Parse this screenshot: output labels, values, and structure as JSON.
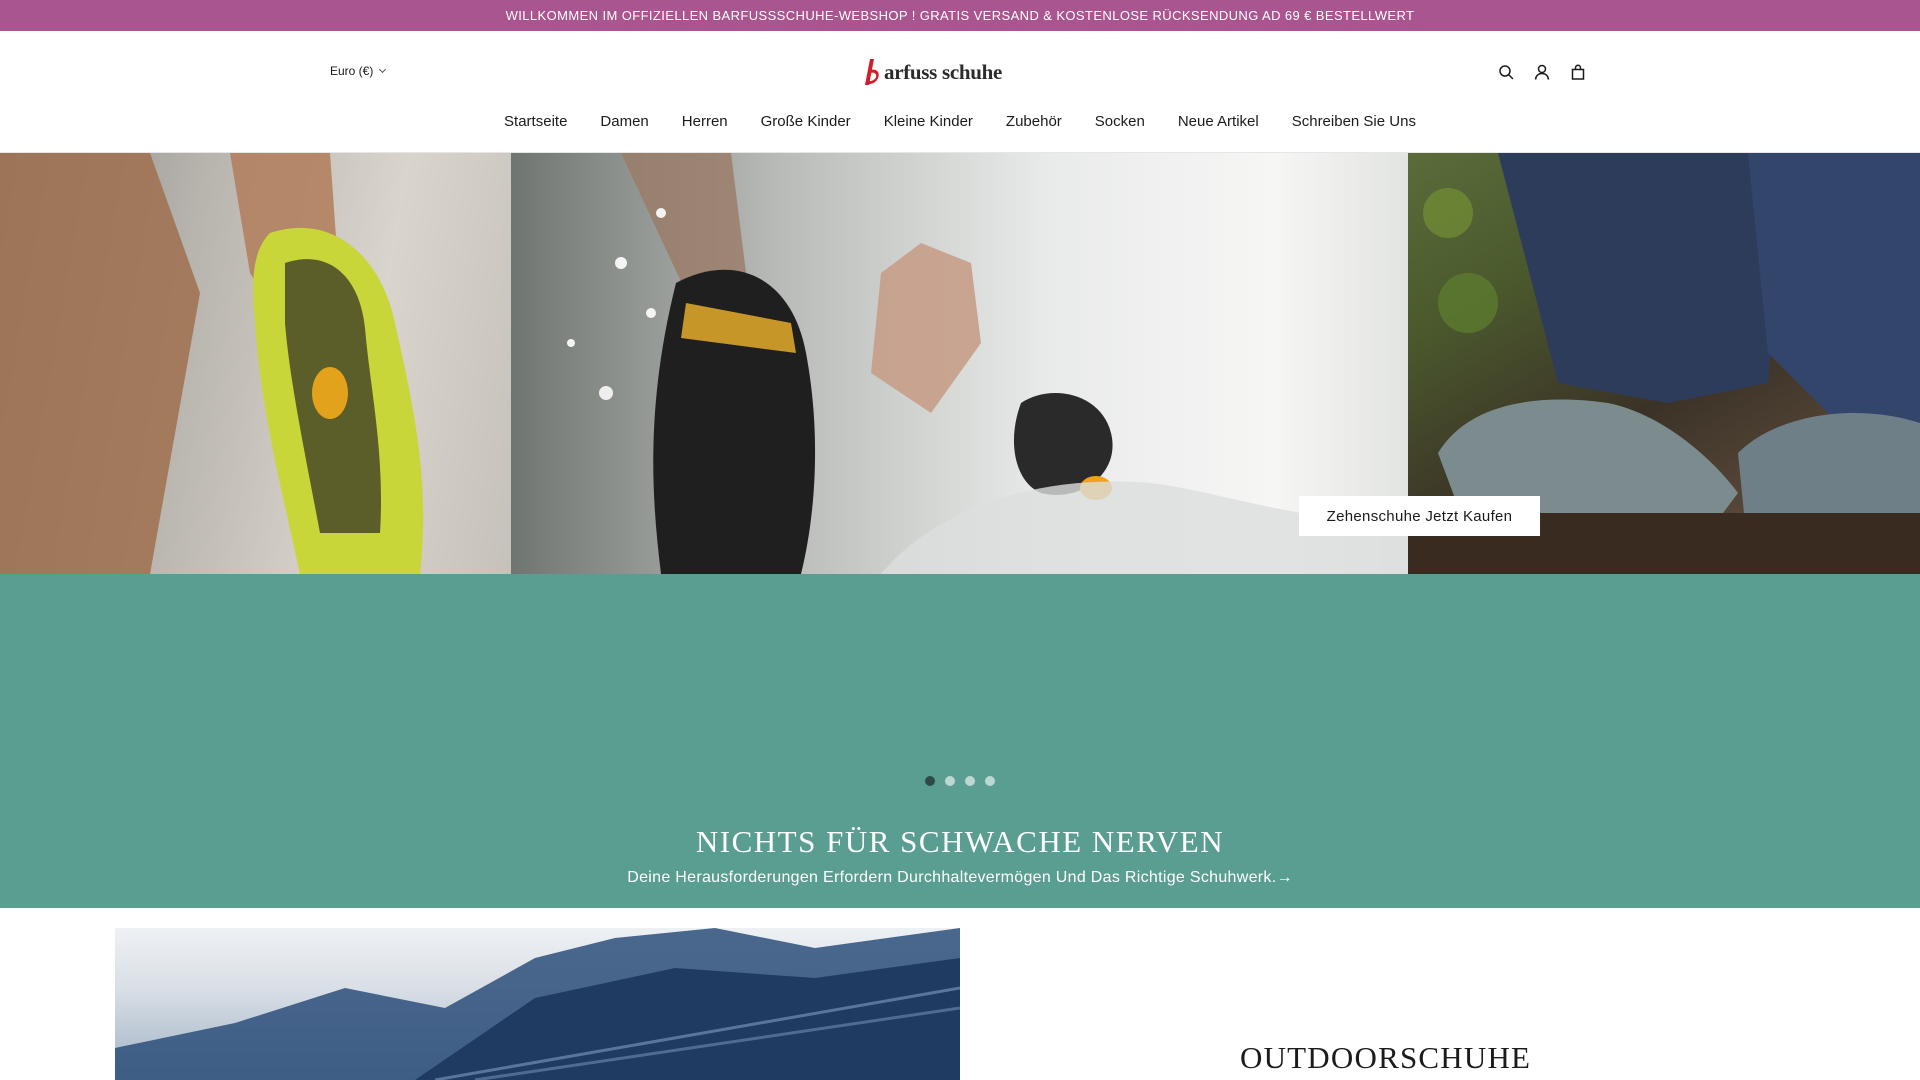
{
  "announcement": {
    "text": "WILLKOMMEN IM OFFIZIELLEN BARFUSSSCHUHE-WEBSHOP ! GRATIS VERSAND & KOSTENLOSE RÜCKSENDUNG AD 69 € BESTELLWERT",
    "background": "#a9558f"
  },
  "header": {
    "currency_label": "Euro (€)",
    "logo_text": "arfuss schuhe",
    "icons": [
      "search-icon",
      "account-icon",
      "cart-icon"
    ]
  },
  "nav": {
    "items": [
      "Startseite",
      "Damen",
      "Herren",
      "Große Kinder",
      "Kleine Kinder",
      "Zubehör",
      "Socken",
      "Neue Artikel",
      "Schreiben Sie Uns"
    ]
  },
  "hero": {
    "cta_label": "Zehenschuhe Jetzt Kaufen",
    "active_slide": 1,
    "slide_count": 4
  },
  "band": {
    "title": "NICHTS FÜR SCHWACHE NERVEN",
    "subtitle": "Deine Herausforderungen Erfordern Durchhaltevermögen Und Das Richtige Schuhwerk.→",
    "background": "#5a9e92"
  },
  "lower": {
    "title": "OUTDOORSCHUHE"
  }
}
